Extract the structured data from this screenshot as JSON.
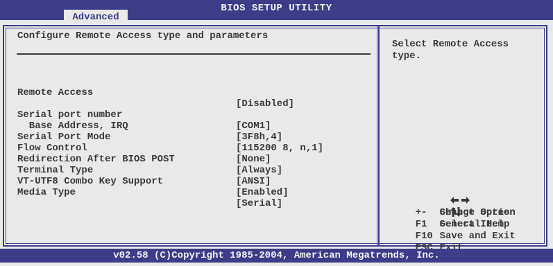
{
  "header": {
    "title": "BIOS SETUP UTILITY",
    "active_tab": "Advanced"
  },
  "main": {
    "heading": "Configure Remote Access type and parameters",
    "settings": [
      {
        "label": "Remote Access",
        "value": "[Disabled]"
      },
      {
        "label": "Serial port number",
        "value": "[COM1]"
      },
      {
        "label": "  Base Address, IRQ",
        "value": "[3F8h,4]"
      },
      {
        "label": "Serial Port Mode",
        "value": "[115200 8, n,1]"
      },
      {
        "label": "Flow Control",
        "value": "[None]"
      },
      {
        "label": "Redirection After BIOS POST",
        "value": "[Always]"
      },
      {
        "label": "Terminal Type",
        "value": "[ANSI]"
      },
      {
        "label": "VT-UTF8 Combo Key Support",
        "value": "[Enabled]"
      },
      {
        "label": "Media Type",
        "value": "[Serial]"
      }
    ]
  },
  "help_panel": {
    "description": "Select Remote Access type.",
    "keys": [
      {
        "key": "",
        "icon": "left-right-arrows-icon",
        "action": "Select Screen"
      },
      {
        "key": "",
        "icon": "up-down-arrows-icon",
        "action": "Select Item"
      },
      {
        "key": "+-",
        "action": "Change Option"
      },
      {
        "key": "F1",
        "action": "General Help"
      },
      {
        "key": "F10",
        "action": "Save and Exit"
      },
      {
        "key": "ESC",
        "action": "Exit"
      }
    ]
  },
  "footer": {
    "text": "v02.58 (C)Copyright 1985-2004, American Megatrends, Inc."
  },
  "colors": {
    "primary_blue": "#3c3c88",
    "background": "#e9e9e9",
    "text": "#3a3a3a"
  }
}
